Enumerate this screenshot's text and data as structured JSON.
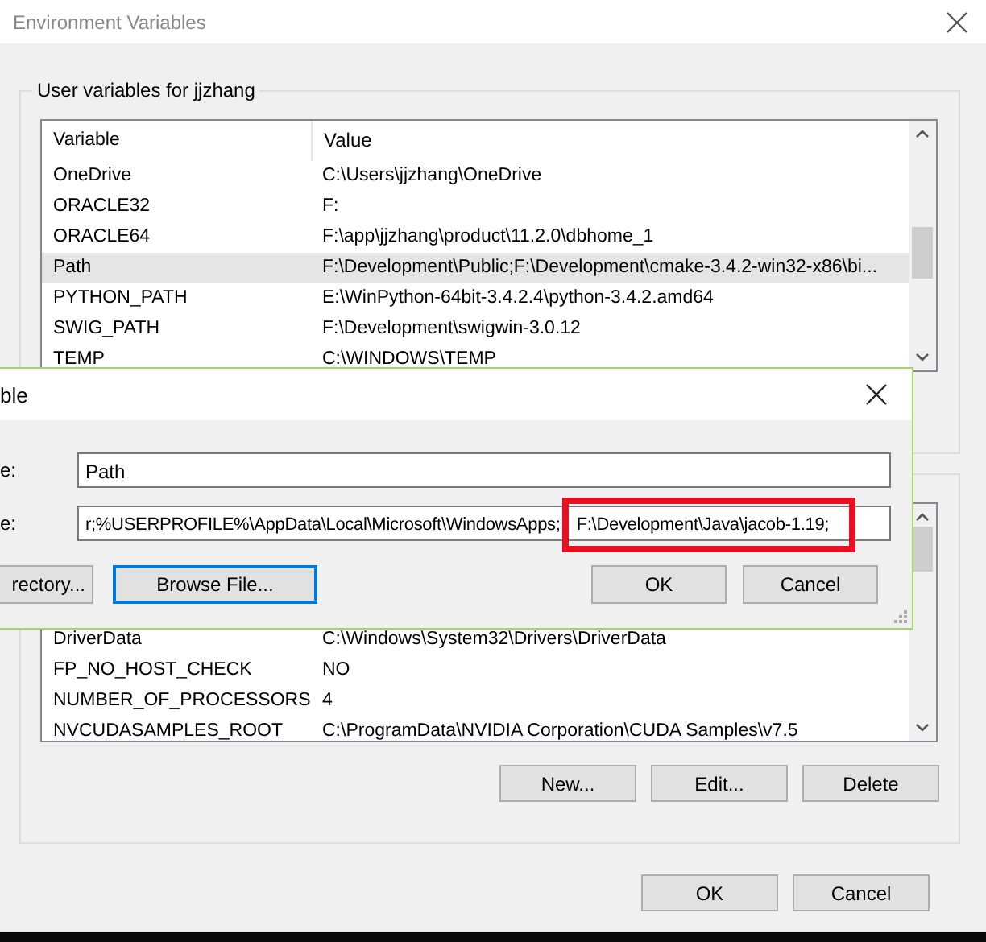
{
  "window": {
    "title": "Environment Variables"
  },
  "user_variables": {
    "title": "User variables for jjzhang",
    "columns": [
      "Variable",
      "Value"
    ],
    "rows": [
      {
        "name": "OneDrive",
        "value": "C:\\Users\\jjzhang\\OneDrive",
        "selected": false
      },
      {
        "name": "ORACLE32",
        "value": "F:",
        "selected": false
      },
      {
        "name": "ORACLE64",
        "value": "F:\\app\\jjzhang\\product\\11.2.0\\dbhome_1",
        "selected": false
      },
      {
        "name": "Path",
        "value": "F:\\Development\\Public;F:\\Development\\cmake-3.4.2-win32-x86\\bi...",
        "selected": true
      },
      {
        "name": "PYTHON_PATH",
        "value": "E:\\WinPython-64bit-3.4.2.4\\python-3.4.2.amd64",
        "selected": false
      },
      {
        "name": "SWIG_PATH",
        "value": "F:\\Development\\swigwin-3.0.12",
        "selected": false
      },
      {
        "name": "TEMP",
        "value": "C:\\WINDOWS\\TEMP",
        "selected": false
      }
    ]
  },
  "system_variables": {
    "rows": [
      {
        "name": "DriverData",
        "value": "C:\\Windows\\System32\\Drivers\\DriverData",
        "selected": false
      },
      {
        "name": "FP_NO_HOST_CHECK",
        "value": "NO",
        "selected": false
      },
      {
        "name": "NUMBER_OF_PROCESSORS",
        "value": "4",
        "selected": false
      },
      {
        "name": "NVCUDASAMPLES_ROOT",
        "value": "C:\\ProgramData\\NVIDIA Corporation\\CUDA Samples\\v7.5",
        "selected": false
      }
    ],
    "buttons": [
      "New...",
      "Edit...",
      "Delete"
    ]
  },
  "buttons": [
    "OK",
    "Cancel"
  ],
  "edit_dialog": {
    "title": "ble",
    "name_label": "e:",
    "name_value": "Path",
    "value_label": "e:",
    "value": [
      {
        "text": "r;%USERPROFILE%\\AppData\\Local\\Microsoft\\WindowsApps;",
        "highlighted": false
      },
      {
        "text": "F:\\Development\\Java\\jacob-1.19;",
        "highlighted": true
      }
    ],
    "buttons": [
      {
        "label": "rectory...",
        "focused": false
      },
      {
        "label": "Browse File...",
        "focused": true
      }
    ],
    "actions": [
      "OK",
      "Cancel"
    ]
  }
}
